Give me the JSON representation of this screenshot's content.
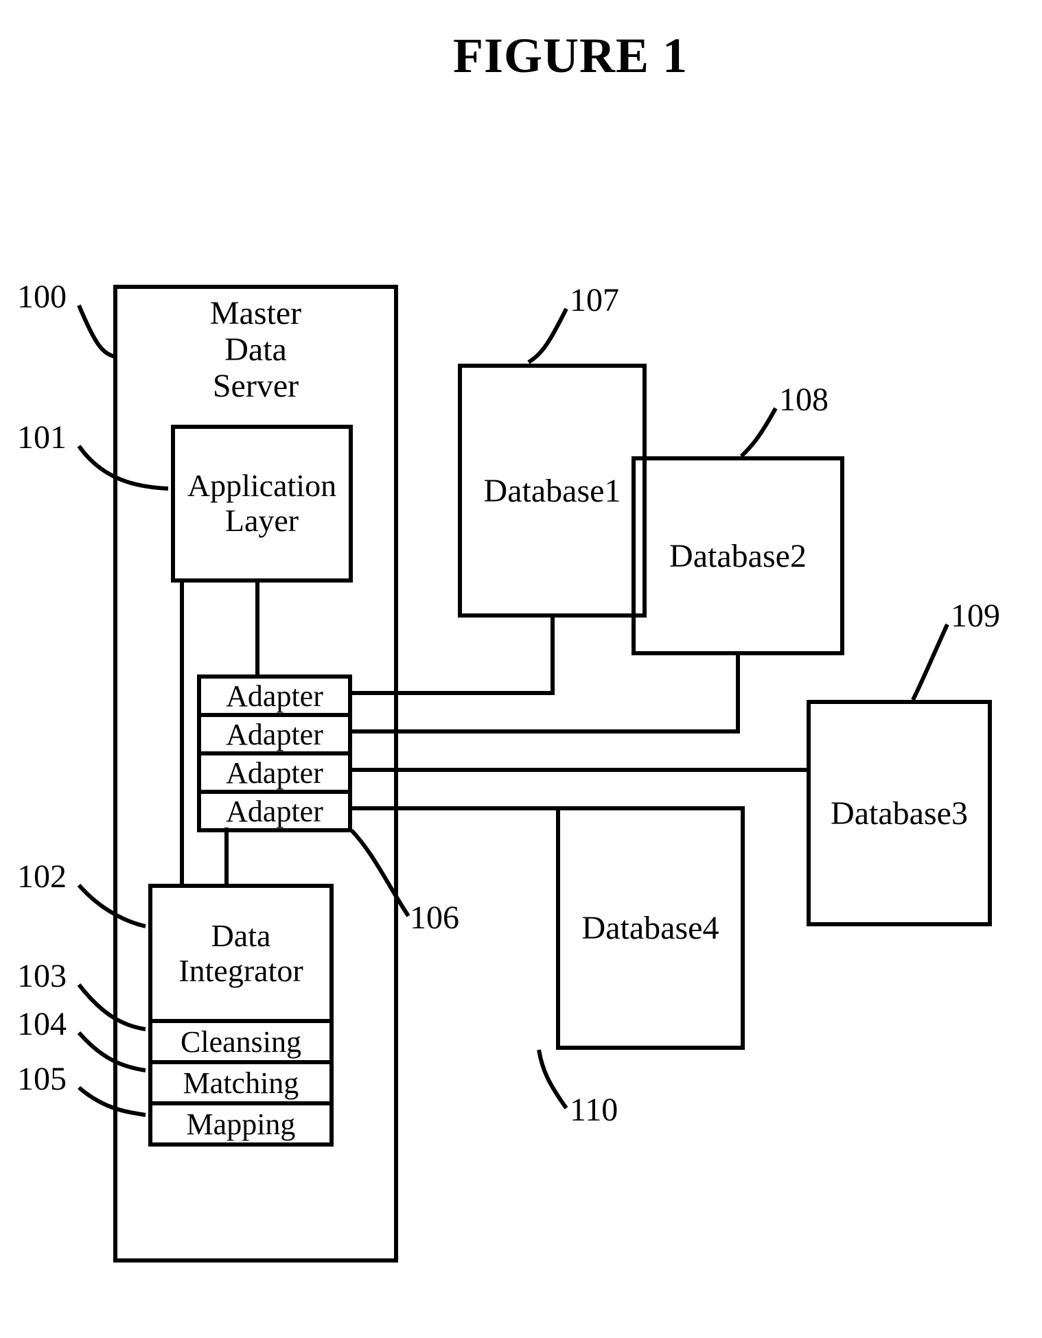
{
  "figure_title": "FIGURE 1",
  "master_data_server": {
    "title_line1": "Master",
    "title_line2": "Data",
    "title_line3": "Server",
    "application_layer": "Application\nLayer",
    "adapters": [
      "Adapter",
      "Adapter",
      "Adapter",
      "Adapter"
    ],
    "data_integrator": {
      "title": "Data\nIntegrator",
      "rows": [
        "Cleansing",
        "Matching",
        "Mapping"
      ]
    }
  },
  "databases": {
    "db1": "Database1",
    "db2": "Database2",
    "db3": "Database3",
    "db4": "Database4"
  },
  "refs": {
    "r100": "100",
    "r101": "101",
    "r102": "102",
    "r103": "103",
    "r104": "104",
    "r105": "105",
    "r106": "106",
    "r107": "107",
    "r108": "108",
    "r109": "109",
    "r110": "110"
  }
}
